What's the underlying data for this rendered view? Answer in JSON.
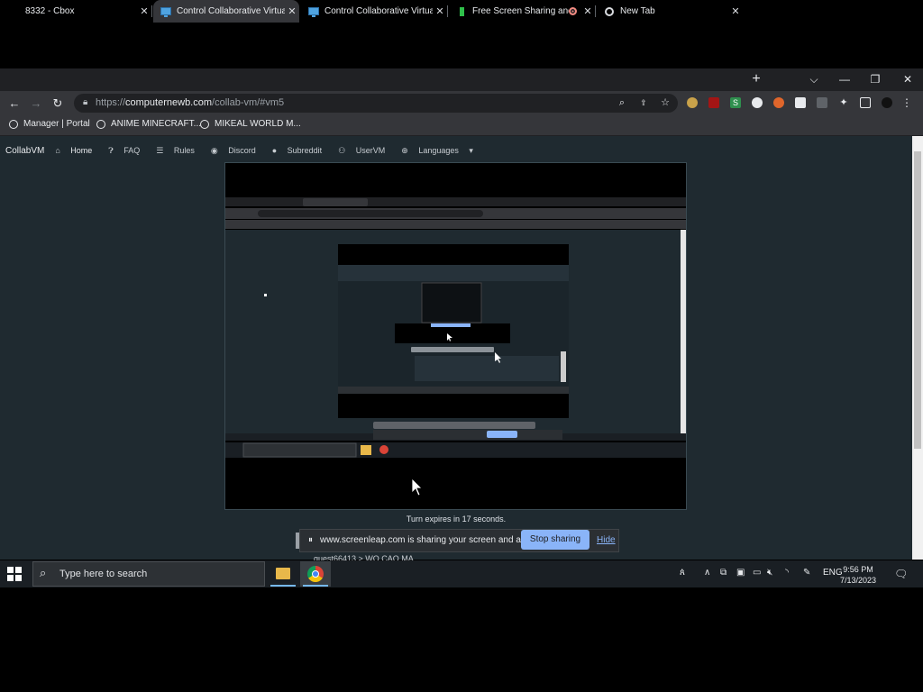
{
  "browser": {
    "tabs": [
      {
        "title": "8332 - Cbox",
        "icon": "none"
      },
      {
        "title": "Control Collaborative Virtual",
        "icon": "monitor-icon"
      },
      {
        "title": "Control Collaborative Virtual",
        "icon": "monitor-icon"
      },
      {
        "title": "Free Screen Sharing and",
        "icon": "screenleap-icon"
      },
      {
        "title": "New Tab",
        "icon": "chrome-icon"
      }
    ],
    "url_scheme": "https://",
    "url_domain": "computernewb.com",
    "url_path": "/collab-vm/#vm5",
    "bookmarks": [
      "Manager | Portal",
      "ANIME MINECRAFT...",
      "MIKEAL WORLD M..."
    ]
  },
  "collabvm": {
    "brand": "CollabVM",
    "nav": [
      "Home",
      "FAQ",
      "Rules",
      "Discord",
      "Subreddit",
      "UserVM",
      "Languages"
    ],
    "turn_text": "Turn expires in 17 seconds."
  },
  "screenshare": {
    "message": "www.screenleap.com is sharing your screen and audio.",
    "stop_label": "Stop sharing",
    "hide_label": "Hide"
  },
  "chat": {
    "partial_line": "guest66413 > WO CAO MA"
  },
  "taskbar": {
    "search_placeholder": "Type here to search",
    "language": "ENG",
    "time": "9:56 PM",
    "date": "7/13/2023"
  },
  "colors": {
    "accent": "#8ab4f8",
    "page_bg": "#1f2a30",
    "tab_active": "#35363a"
  }
}
